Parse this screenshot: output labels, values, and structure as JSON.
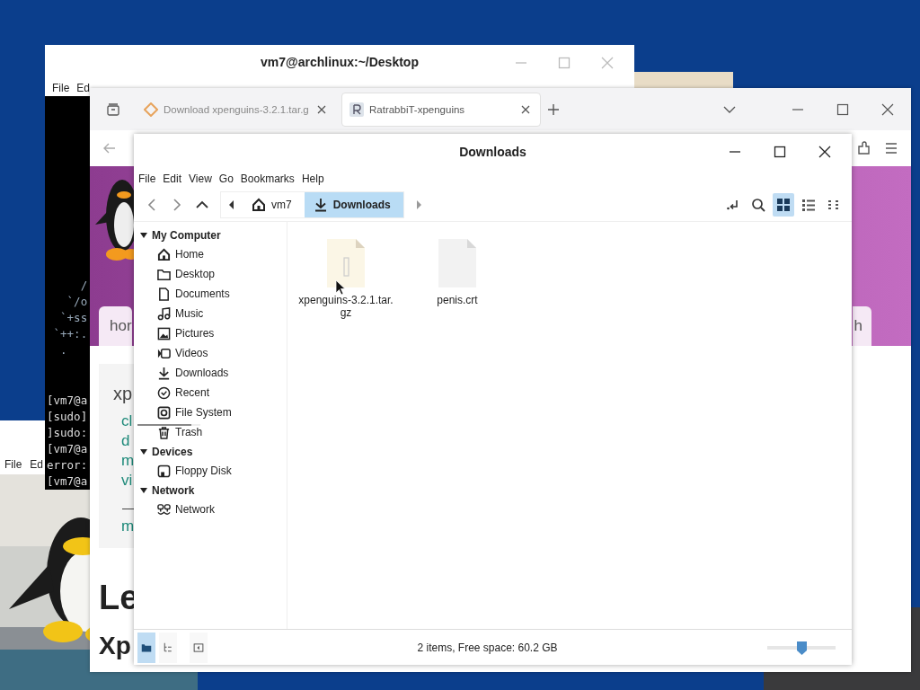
{
  "terminal": {
    "title": "vm7@archlinux:~/Desktop",
    "menu": [
      "File",
      "Ed"
    ],
    "art": [
      "     /",
      "   `/o",
      "  `+ss",
      " `++:.",
      "  ."
    ],
    "lines": [
      "[vm7@a",
      "[sudo]",
      "]sudo:",
      "[vm7@a",
      "error:",
      "[vm7@a"
    ]
  },
  "image_window": {
    "menu": [
      "File",
      "Ed"
    ],
    "body": {
      "kind": "picture"
    }
  },
  "browser": {
    "tabs": [
      {
        "label": "Download xpenguins-3.2.1.tar.g",
        "selected": false
      },
      {
        "label": "RatrabbiT-xpenguins",
        "selected": true
      }
    ],
    "page": {
      "nav": [
        "hor",
        "h"
      ],
      "card_title": "xp",
      "links": [
        "cl",
        "d",
        "m",
        "vi"
      ],
      "footer_link": "m",
      "headings": [
        "Le",
        "Xp"
      ]
    }
  },
  "file_manager": {
    "title": "Downloads",
    "menu": [
      "File",
      "Edit",
      "View",
      "Go",
      "Bookmarks",
      "Help"
    ],
    "breadcrumb": [
      {
        "label": "vm7",
        "kind": "home",
        "selected": false
      },
      {
        "label": "Downloads",
        "kind": "download",
        "selected": true
      }
    ],
    "views": [
      {
        "kind": "icons",
        "selected": true
      },
      {
        "kind": "list",
        "selected": false
      },
      {
        "kind": "compact",
        "selected": false
      }
    ],
    "sidebar": [
      {
        "label": "My Computer",
        "expanded": true,
        "children": [
          {
            "label": "Home",
            "kind": "home"
          },
          {
            "label": "Desktop",
            "kind": "folder"
          },
          {
            "label": "Documents",
            "kind": "document"
          },
          {
            "label": "Music",
            "kind": "music"
          },
          {
            "label": "Pictures",
            "kind": "picture"
          },
          {
            "label": "Videos",
            "kind": "video"
          },
          {
            "label": "Downloads",
            "kind": "download"
          },
          {
            "label": "Recent",
            "kind": "recent"
          },
          {
            "label": "File System",
            "kind": "disk",
            "level": 0.85
          },
          {
            "label": "Trash",
            "kind": "trash"
          }
        ]
      },
      {
        "label": "Devices",
        "expanded": true,
        "children": [
          {
            "label": "Floppy Disk",
            "kind": "floppy"
          }
        ]
      },
      {
        "label": "Network",
        "expanded": true,
        "children": [
          {
            "label": "Network",
            "kind": "network"
          }
        ]
      }
    ],
    "files": [
      {
        "name": "xpenguins-3.2.1.tar.gz",
        "kind": "archive"
      },
      {
        "name": "penis.crt",
        "kind": "document"
      }
    ],
    "panes": [
      {
        "kind": "places",
        "selected": true
      },
      {
        "kind": "tree",
        "selected": false
      }
    ],
    "status": "2 items, Free space: 60.2 GB",
    "zoom": {
      "level": 0.5
    }
  }
}
